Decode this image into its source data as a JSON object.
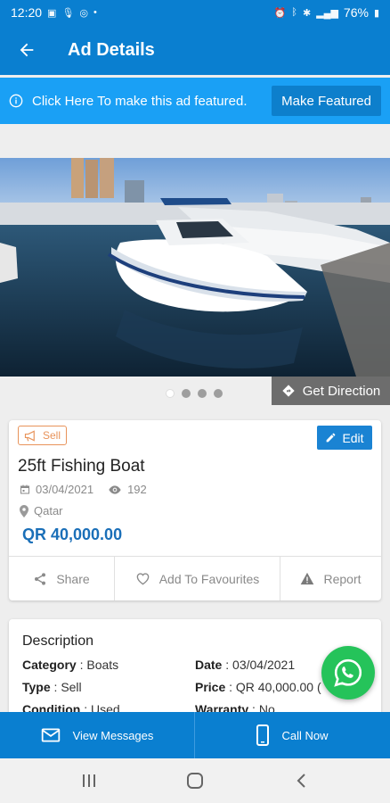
{
  "status_bar": {
    "time": "12:20",
    "battery": "76%"
  },
  "app_bar": {
    "title": "Ad Details"
  },
  "featured": {
    "message": "Click Here To make this ad featured.",
    "button": "Make Featured"
  },
  "gallery": {
    "dot_count": 4,
    "active_index": 0,
    "direction_label": "Get Direction"
  },
  "ad": {
    "badge": "Sell",
    "edit_label": "Edit",
    "title": "25ft Fishing Boat",
    "date": "03/04/2021",
    "views": "192",
    "location": "Qatar",
    "price": "QR 40,000.00",
    "actions": {
      "share": "Share",
      "favourite": "Add To Favourites",
      "report": "Report"
    }
  },
  "description": {
    "title": "Description",
    "category_label": "Category",
    "category_value": "Boats",
    "date_label": "Date",
    "date_value": "03/04/2021",
    "type_label": "Type",
    "type_value": "Sell",
    "price_label": "Price",
    "price_value": "QR 40,000.00 (",
    "condition_label": "Condition",
    "condition_value": "Used",
    "warranty_label": "Warranty",
    "warranty_value": "No"
  },
  "bottom_bar": {
    "messages": "View Messages",
    "call": "Call Now"
  },
  "colors": {
    "primary": "#0a7fd0",
    "featured": "#1aa0f5",
    "price": "#1a6fb8",
    "whatsapp": "#25c35a",
    "sell_badge": "#e8935a"
  }
}
